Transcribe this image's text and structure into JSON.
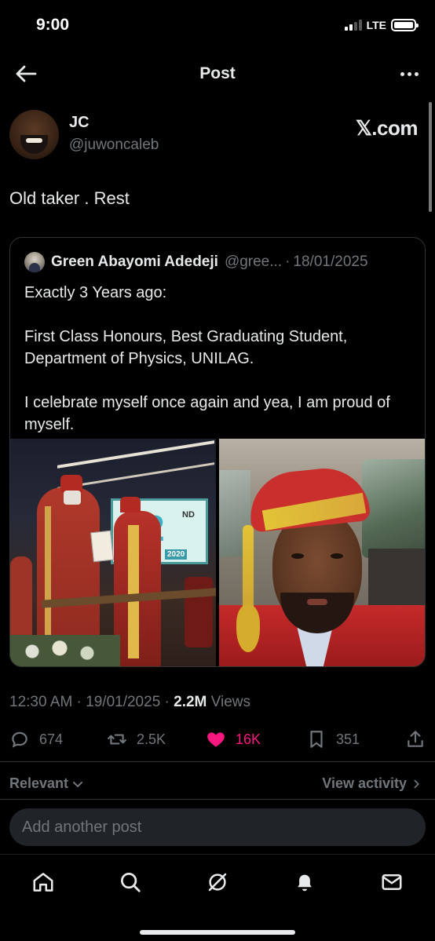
{
  "status_bar": {
    "time": "9:00",
    "network": "LTE",
    "icons": [
      "signal-icon",
      "battery-icon"
    ]
  },
  "header": {
    "title": "Post",
    "back_icon": "back-arrow-icon",
    "more_icon": "more-icon"
  },
  "post": {
    "author_name": "JC",
    "author_handle": "@juwoncaleb",
    "watermark": "𝕏.com",
    "text": "Old taker . Rest",
    "timestamp": "12:30 AM · 19/01/2025 · ",
    "views_count": "2.2M",
    "views_label": " Views"
  },
  "quote": {
    "author_name": "Green Abayomi Adedeji",
    "author_handle": "@gree...",
    "separator": "·",
    "date": "18/01/2025",
    "paragraph_1": "Exactly 3 Years ago:",
    "paragraph_2": "First Class Honours, Best Graduating Student, Department of Physics, UNILAG.",
    "paragraph_3": "I celebrate myself once again and yea, I am proud of myself.",
    "banner_number": "2",
    "banner_suffix": "ND",
    "banner_year": "2020"
  },
  "actions": {
    "replies": "674",
    "reposts": "2.5K",
    "likes": "16K",
    "bookmarks": "351"
  },
  "replies_section": {
    "sort_label": "Relevant",
    "view_activity": "View activity",
    "reply_placeholder": "Add another post"
  },
  "bottom_nav": [
    "home-icon",
    "search-icon",
    "grok-icon",
    "notifications-icon",
    "messages-icon"
  ],
  "colors": {
    "background": "#000000",
    "text": "#e7e9ea",
    "secondary": "#71767b",
    "like": "#f91880",
    "border": "#2f3336",
    "input_bg": "#202327"
  }
}
